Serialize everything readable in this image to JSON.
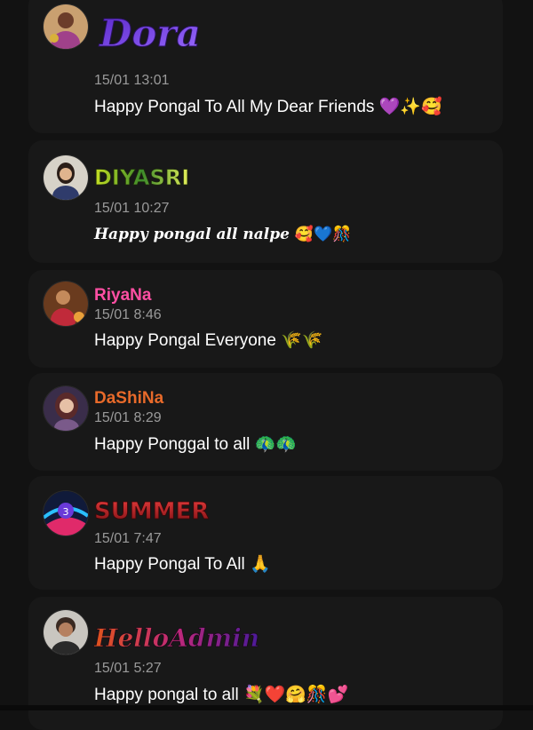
{
  "messages": [
    {
      "user": "Dora",
      "time": "15/01 13:01",
      "text": "Happy Pongal To All My Dear Friends",
      "emoji": "💜✨🥰",
      "name_color": "#7b3fe4"
    },
    {
      "user": "DIYASRI",
      "time": "15/01 10:27",
      "text": "Happy pongal all nalpe",
      "emoji": "🥰💙🎊",
      "name_color": "#d8e22a"
    },
    {
      "user": "RiyaNa",
      "time": "15/01 8:46",
      "text": "Happy Pongal Everyone",
      "emoji": "🌾🌾",
      "name_color": "#ff4fa3"
    },
    {
      "user": "DaShiNa",
      "time": "15/01 8:29",
      "text": "Happy Ponggal to all",
      "emoji": "🦚🦚",
      "name_color": "#e86a2a"
    },
    {
      "user": "SUMMER",
      "time": "15/01 7:47",
      "text": "Happy Pongal To All",
      "emoji": "🙏",
      "name_color": "#c0262c"
    },
    {
      "user": "HelloAdmin",
      "time": "15/01 5:27",
      "text": "Happy pongal to all",
      "emoji": "💐❤️🤗🎊💕",
      "name_color": "#b0337a"
    }
  ]
}
